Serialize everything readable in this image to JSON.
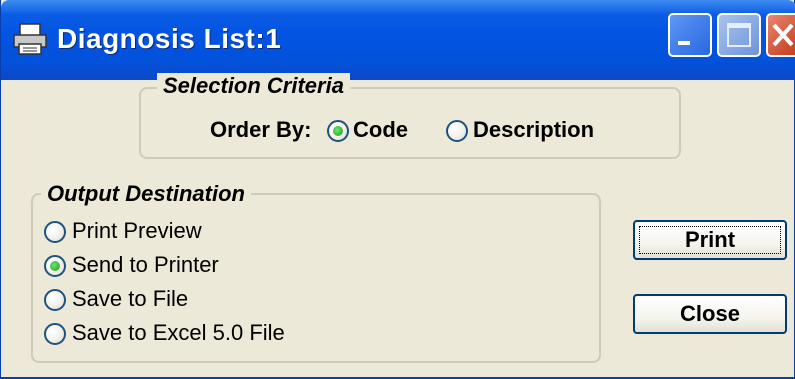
{
  "window": {
    "title": "Diagnosis List:1",
    "title_icon": "printer-icon",
    "minimize_icon": "minimize-icon",
    "maximize_icon": "maximize-icon",
    "close_icon": "close-icon"
  },
  "selection": {
    "legend": "Selection Criteria",
    "order_by_label": "Order By:",
    "options": [
      {
        "label": "Code",
        "selected": true
      },
      {
        "label": "Description",
        "selected": false
      }
    ]
  },
  "output": {
    "legend": "Output Destination",
    "options": [
      {
        "label": "Print Preview",
        "selected": false
      },
      {
        "label": "Send to Printer",
        "selected": true
      },
      {
        "label": "Save to File",
        "selected": false
      },
      {
        "label": "Save to Excel 5.0 File",
        "selected": false
      }
    ]
  },
  "buttons": {
    "print_label": "Print",
    "close_label": "Close"
  },
  "colors": {
    "title_bar": "#0454e3",
    "window_bg": "#ece9d8",
    "radio_selected": "#2fae2f"
  }
}
